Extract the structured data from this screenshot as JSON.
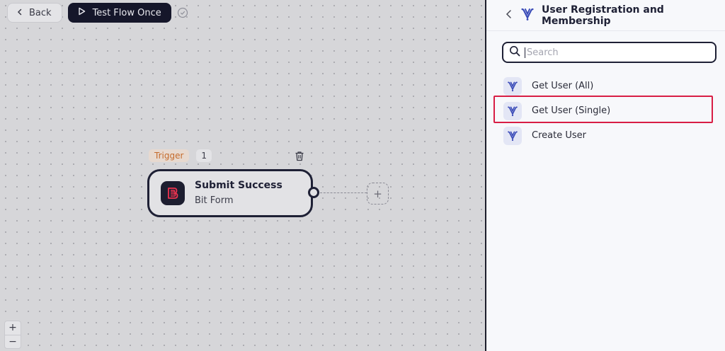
{
  "toolbar": {
    "back_label": "Back",
    "test_label": "Test Flow Once"
  },
  "node": {
    "trigger_badge": "Trigger",
    "step_number": "1",
    "title": "Submit Success",
    "subtitle": "Bit Form"
  },
  "panel": {
    "title": "User Registration and Membership",
    "search": {
      "placeholder": "Search",
      "value": ""
    },
    "actions": [
      {
        "label": "Get User (All)",
        "icon": "membership-logo-icon"
      },
      {
        "label": "Get User (Single)",
        "icon": "membership-logo-icon",
        "highlighted": true
      },
      {
        "label": "Create User",
        "icon": "membership-logo-icon"
      }
    ]
  },
  "zoom": {
    "in_label": "+",
    "out_label": "−"
  },
  "colors": {
    "accent_dark": "#15162a",
    "trigger_orange": "#c56b2c",
    "highlight_red": "#d81d44",
    "brand_blue": "#3b4cb8"
  }
}
